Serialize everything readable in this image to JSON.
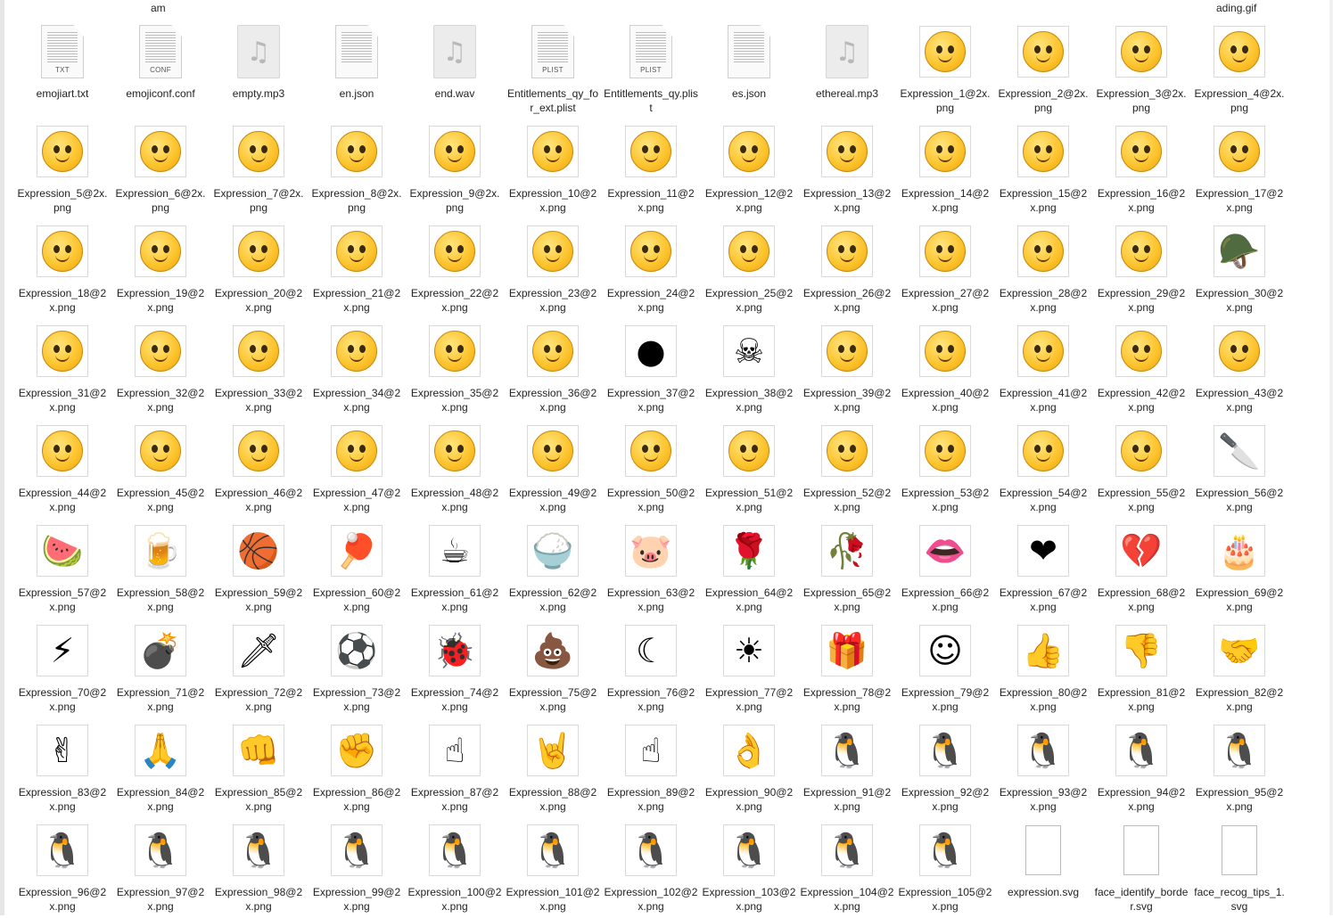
{
  "top_captions": {
    "left": "am",
    "right": "ading.gif"
  },
  "files": [
    {
      "name": "emojiart.txt",
      "kind": "doc",
      "ext": "TXT"
    },
    {
      "name": "emojiconf.conf",
      "kind": "doc",
      "ext": "CONF"
    },
    {
      "name": "empty.mp3",
      "kind": "audio"
    },
    {
      "name": "en.json",
      "kind": "doc",
      "ext": ""
    },
    {
      "name": "end.wav",
      "kind": "audio"
    },
    {
      "name": "Entitlements_qy_for_ext.plist",
      "kind": "doc",
      "ext": "PLIST"
    },
    {
      "name": "Entitlements_qy.plist",
      "kind": "doc",
      "ext": "PLIST"
    },
    {
      "name": "es.json",
      "kind": "doc",
      "ext": ""
    },
    {
      "name": "ethereal.mp3",
      "kind": "audio"
    },
    {
      "name": "Expression_1@2x.png",
      "kind": "face"
    },
    {
      "name": "Expression_2@2x.png",
      "kind": "face"
    },
    {
      "name": "Expression_3@2x.png",
      "kind": "face"
    },
    {
      "name": "Expression_4@2x.png",
      "kind": "face"
    },
    {
      "name": "Expression_5@2x.png",
      "kind": "face"
    },
    {
      "name": "Expression_6@2x.png",
      "kind": "face"
    },
    {
      "name": "Expression_7@2x.png",
      "kind": "face"
    },
    {
      "name": "Expression_8@2x.png",
      "kind": "face"
    },
    {
      "name": "Expression_9@2x.png",
      "kind": "face"
    },
    {
      "name": "Expression_10@2x.png",
      "kind": "face"
    },
    {
      "name": "Expression_11@2x.png",
      "kind": "face"
    },
    {
      "name": "Expression_12@2x.png",
      "kind": "face"
    },
    {
      "name": "Expression_13@2x.png",
      "kind": "face"
    },
    {
      "name": "Expression_14@2x.png",
      "kind": "face"
    },
    {
      "name": "Expression_15@2x.png",
      "kind": "face"
    },
    {
      "name": "Expression_16@2x.png",
      "kind": "face"
    },
    {
      "name": "Expression_17@2x.png",
      "kind": "face"
    },
    {
      "name": "Expression_18@2x.png",
      "kind": "face"
    },
    {
      "name": "Expression_19@2x.png",
      "kind": "face"
    },
    {
      "name": "Expression_20@2x.png",
      "kind": "face"
    },
    {
      "name": "Expression_21@2x.png",
      "kind": "face"
    },
    {
      "name": "Expression_22@2x.png",
      "kind": "face"
    },
    {
      "name": "Expression_23@2x.png",
      "kind": "face"
    },
    {
      "name": "Expression_24@2x.png",
      "kind": "face"
    },
    {
      "name": "Expression_25@2x.png",
      "kind": "face"
    },
    {
      "name": "Expression_26@2x.png",
      "kind": "face"
    },
    {
      "name": "Expression_27@2x.png",
      "kind": "face"
    },
    {
      "name": "Expression_28@2x.png",
      "kind": "face"
    },
    {
      "name": "Expression_29@2x.png",
      "kind": "face"
    },
    {
      "name": "Expression_30@2x.png",
      "kind": "glyph",
      "glyph": "🪖"
    },
    {
      "name": "Expression_31@2x.png",
      "kind": "face"
    },
    {
      "name": "Expression_32@2x.png",
      "kind": "face"
    },
    {
      "name": "Expression_33@2x.png",
      "kind": "face"
    },
    {
      "name": "Expression_34@2x.png",
      "kind": "face"
    },
    {
      "name": "Expression_35@2x.png",
      "kind": "face"
    },
    {
      "name": "Expression_36@2x.png",
      "kind": "face"
    },
    {
      "name": "Expression_37@2x.png",
      "kind": "glyph",
      "glyph": "●"
    },
    {
      "name": "Expression_38@2x.png",
      "kind": "glyph",
      "glyph": "☠"
    },
    {
      "name": "Expression_39@2x.png",
      "kind": "face"
    },
    {
      "name": "Expression_40@2x.png",
      "kind": "face"
    },
    {
      "name": "Expression_41@2x.png",
      "kind": "face"
    },
    {
      "name": "Expression_42@2x.png",
      "kind": "face"
    },
    {
      "name": "Expression_43@2x.png",
      "kind": "face"
    },
    {
      "name": "Expression_44@2x.png",
      "kind": "face"
    },
    {
      "name": "Expression_45@2x.png",
      "kind": "face"
    },
    {
      "name": "Expression_46@2x.png",
      "kind": "face"
    },
    {
      "name": "Expression_47@2x.png",
      "kind": "face"
    },
    {
      "name": "Expression_48@2x.png",
      "kind": "face"
    },
    {
      "name": "Expression_49@2x.png",
      "kind": "face"
    },
    {
      "name": "Expression_50@2x.png",
      "kind": "face"
    },
    {
      "name": "Expression_51@2x.png",
      "kind": "face"
    },
    {
      "name": "Expression_52@2x.png",
      "kind": "face"
    },
    {
      "name": "Expression_53@2x.png",
      "kind": "face"
    },
    {
      "name": "Expression_54@2x.png",
      "kind": "face"
    },
    {
      "name": "Expression_55@2x.png",
      "kind": "face"
    },
    {
      "name": "Expression_56@2x.png",
      "kind": "glyph",
      "glyph": "🔪"
    },
    {
      "name": "Expression_57@2x.png",
      "kind": "glyph",
      "glyph": "🍉"
    },
    {
      "name": "Expression_58@2x.png",
      "kind": "glyph",
      "glyph": "🍺"
    },
    {
      "name": "Expression_59@2x.png",
      "kind": "glyph",
      "glyph": "🏀"
    },
    {
      "name": "Expression_60@2x.png",
      "kind": "glyph",
      "glyph": "🏓"
    },
    {
      "name": "Expression_61@2x.png",
      "kind": "glyph",
      "glyph": "☕"
    },
    {
      "name": "Expression_62@2x.png",
      "kind": "glyph",
      "glyph": "🍚"
    },
    {
      "name": "Expression_63@2x.png",
      "kind": "glyph",
      "glyph": "🐷"
    },
    {
      "name": "Expression_64@2x.png",
      "kind": "glyph",
      "glyph": "🌹"
    },
    {
      "name": "Expression_65@2x.png",
      "kind": "glyph",
      "glyph": "🥀"
    },
    {
      "name": "Expression_66@2x.png",
      "kind": "glyph",
      "glyph": "👄"
    },
    {
      "name": "Expression_67@2x.png",
      "kind": "glyph",
      "glyph": "❤"
    },
    {
      "name": "Expression_68@2x.png",
      "kind": "glyph",
      "glyph": "💔"
    },
    {
      "name": "Expression_69@2x.png",
      "kind": "glyph",
      "glyph": "🎂"
    },
    {
      "name": "Expression_70@2x.png",
      "kind": "glyph",
      "glyph": "⚡"
    },
    {
      "name": "Expression_71@2x.png",
      "kind": "glyph",
      "glyph": "💣"
    },
    {
      "name": "Expression_72@2x.png",
      "kind": "glyph",
      "glyph": "🗡"
    },
    {
      "name": "Expression_73@2x.png",
      "kind": "glyph",
      "glyph": "⚽"
    },
    {
      "name": "Expression_74@2x.png",
      "kind": "glyph",
      "glyph": "🐞"
    },
    {
      "name": "Expression_75@2x.png",
      "kind": "glyph",
      "glyph": "💩"
    },
    {
      "name": "Expression_76@2x.png",
      "kind": "glyph",
      "glyph": "☾"
    },
    {
      "name": "Expression_77@2x.png",
      "kind": "glyph",
      "glyph": "☀"
    },
    {
      "name": "Expression_78@2x.png",
      "kind": "glyph",
      "glyph": "🎁"
    },
    {
      "name": "Expression_79@2x.png",
      "kind": "glyph",
      "glyph": "☺"
    },
    {
      "name": "Expression_80@2x.png",
      "kind": "glyph",
      "glyph": "👍"
    },
    {
      "name": "Expression_81@2x.png",
      "kind": "glyph",
      "glyph": "👎"
    },
    {
      "name": "Expression_82@2x.png",
      "kind": "glyph",
      "glyph": "🤝"
    },
    {
      "name": "Expression_83@2x.png",
      "kind": "glyph",
      "glyph": "✌"
    },
    {
      "name": "Expression_84@2x.png",
      "kind": "glyph",
      "glyph": "🙏"
    },
    {
      "name": "Expression_85@2x.png",
      "kind": "glyph",
      "glyph": "👊"
    },
    {
      "name": "Expression_86@2x.png",
      "kind": "glyph",
      "glyph": "✊"
    },
    {
      "name": "Expression_87@2x.png",
      "kind": "glyph",
      "glyph": "☝"
    },
    {
      "name": "Expression_88@2x.png",
      "kind": "glyph",
      "glyph": "🤘"
    },
    {
      "name": "Expression_89@2x.png",
      "kind": "glyph",
      "glyph": "☝"
    },
    {
      "name": "Expression_90@2x.png",
      "kind": "glyph",
      "glyph": "👌"
    },
    {
      "name": "Expression_91@2x.png",
      "kind": "glyph",
      "glyph": "🐧"
    },
    {
      "name": "Expression_92@2x.png",
      "kind": "glyph",
      "glyph": "🐧"
    },
    {
      "name": "Expression_93@2x.png",
      "kind": "glyph",
      "glyph": "🐧"
    },
    {
      "name": "Expression_94@2x.png",
      "kind": "glyph",
      "glyph": "🐧"
    },
    {
      "name": "Expression_95@2x.png",
      "kind": "glyph",
      "glyph": "🐧"
    },
    {
      "name": "Expression_96@2x.png",
      "kind": "glyph",
      "glyph": "🐧"
    },
    {
      "name": "Expression_97@2x.png",
      "kind": "glyph",
      "glyph": "🐧"
    },
    {
      "name": "Expression_98@2x.png",
      "kind": "glyph",
      "glyph": "🐧"
    },
    {
      "name": "Expression_99@2x.png",
      "kind": "glyph",
      "glyph": "🐧"
    },
    {
      "name": "Expression_100@2x.png",
      "kind": "glyph",
      "glyph": "🐧"
    },
    {
      "name": "Expression_101@2x.png",
      "kind": "glyph",
      "glyph": "🐧"
    },
    {
      "name": "Expression_102@2x.png",
      "kind": "glyph",
      "glyph": "🐧"
    },
    {
      "name": "Expression_103@2x.png",
      "kind": "glyph",
      "glyph": "🐧"
    },
    {
      "name": "Expression_104@2x.png",
      "kind": "glyph",
      "glyph": "🐧"
    },
    {
      "name": "Expression_105@2x.png",
      "kind": "glyph",
      "glyph": "🐧"
    },
    {
      "name": "expression.svg",
      "kind": "blank"
    },
    {
      "name": "face_identify_border.svg",
      "kind": "blank"
    },
    {
      "name": "face_recog_tips_1.svg",
      "kind": "blank"
    }
  ]
}
